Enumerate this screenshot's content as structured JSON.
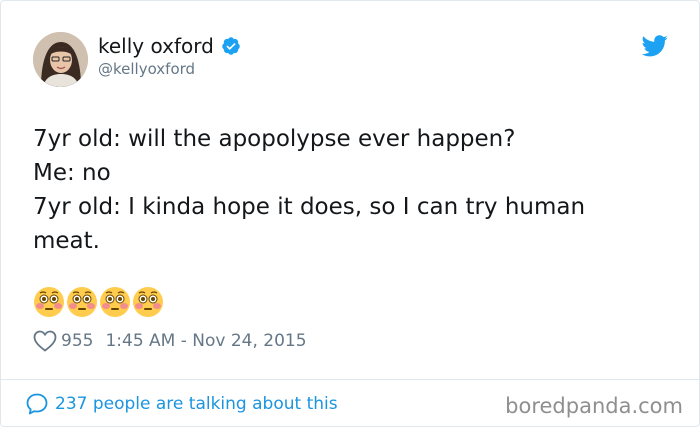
{
  "author": {
    "display_name": "kelly oxford",
    "handle": "@kellyoxford",
    "verified_icon": "verified-badge-icon",
    "avatar_icon": "profile-photo"
  },
  "platform_icon": "twitter-bird-icon",
  "tweet": {
    "lines": [
      "7yr old: will the apopolypse ever happen?",
      "Me: no",
      "7yr old: I kinda hope it does, so I can try human",
      "meat."
    ],
    "emojis": [
      "flushed-face",
      "flushed-face",
      "flushed-face",
      "flushed-face"
    ]
  },
  "meta": {
    "like_count": "955",
    "timestamp": "1:45 AM - Nov 24, 2015"
  },
  "footer": {
    "talking_label": "237 people are talking about this",
    "watermark": "boredpanda.com"
  },
  "colors": {
    "link_blue": "#1b95e0",
    "twitter_blue": "#1da1f2",
    "muted_gray": "#657786",
    "text": "#14171a"
  }
}
